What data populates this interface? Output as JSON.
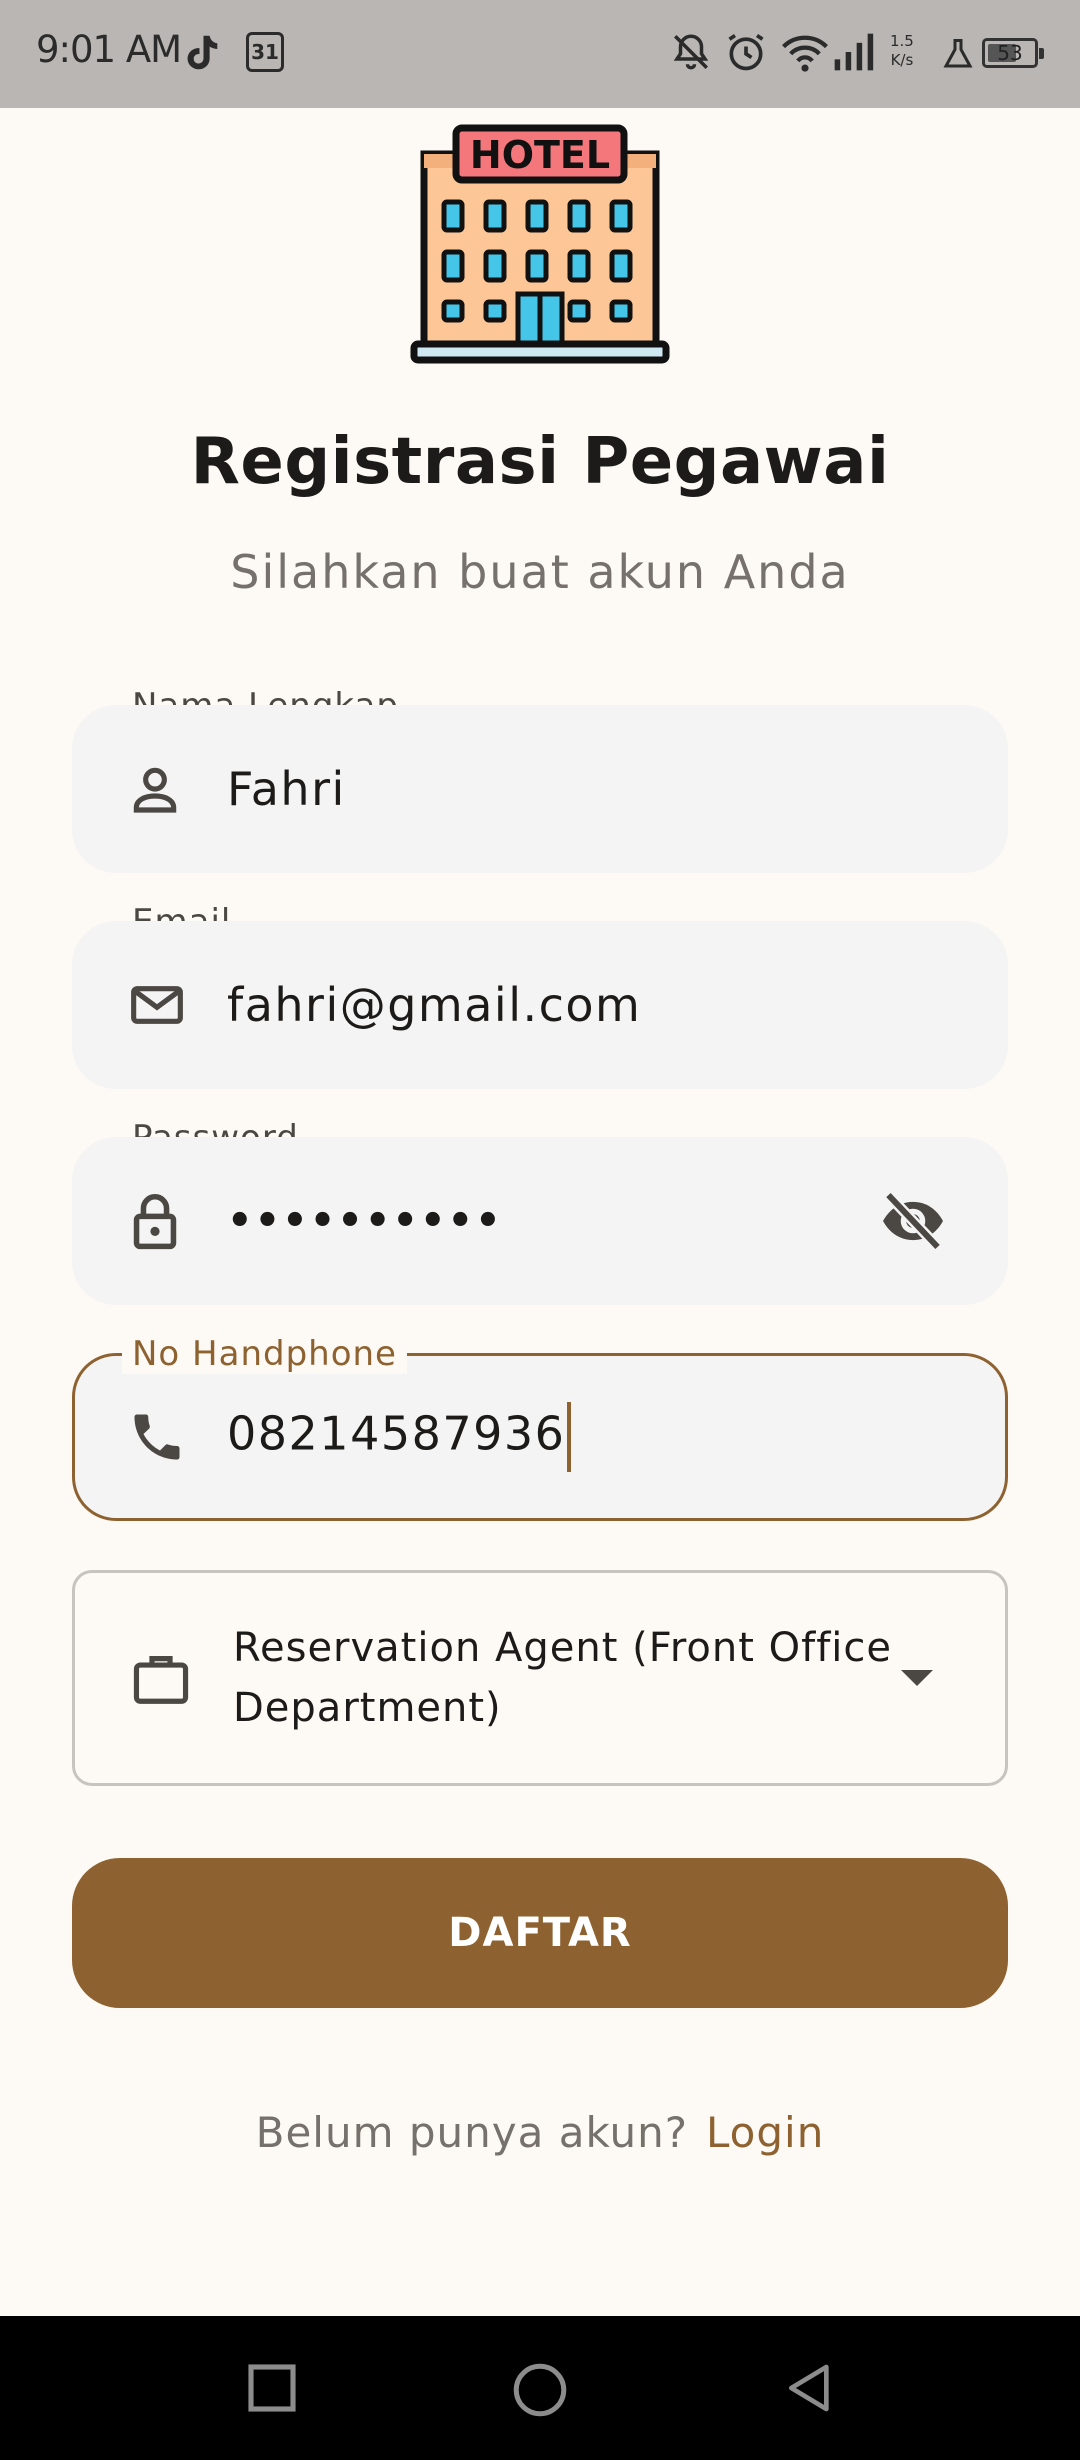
{
  "status_bar": {
    "time": "9:01 AM",
    "calendar_day": "31",
    "net_speed_value": "1.5",
    "net_speed_unit": "K/s",
    "battery": "53"
  },
  "header": {
    "logo_text": "HOTEL",
    "title": "Registrasi Pegawai",
    "subtitle": "Silahkan buat akun Anda"
  },
  "form": {
    "name": {
      "label": "Nama Lengkap",
      "value": "Fahri",
      "icon": "person-icon"
    },
    "email": {
      "label": "Email",
      "value": "fahri@gmail.com",
      "icon": "mail-icon"
    },
    "password": {
      "label": "Password",
      "value": "••••••••••",
      "icon": "lock-icon",
      "toggle_icon": "eye-off-icon"
    },
    "phone": {
      "label": "No Handphone",
      "value": "08214587936",
      "icon": "phone-icon",
      "focused": true
    },
    "position": {
      "value": "Reservation Agent (Front Office Department)",
      "icon": "briefcase-icon"
    },
    "submit_label": "DAFTAR"
  },
  "footer": {
    "prompt": "Belum punya akun?",
    "link": "Login"
  },
  "colors": {
    "accent": "#8e6230",
    "background": "#fdf9f4",
    "field_bg": "#f4f4f4"
  }
}
